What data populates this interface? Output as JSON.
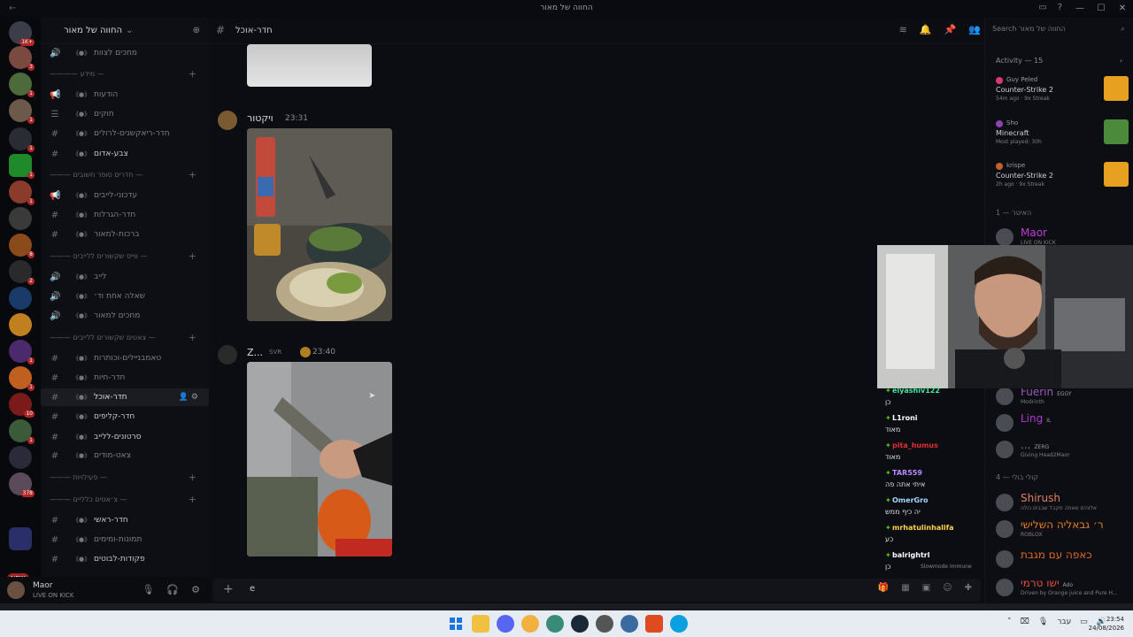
{
  "window": {
    "title": "החווה של מאור",
    "back_glyph": "←",
    "controls": [
      "—",
      "☐",
      "✕"
    ],
    "top_icons": [
      "▭",
      "?"
    ]
  },
  "servers": {
    "new_label": "NEW",
    "badges": [
      "1K+",
      "3",
      "1",
      "1",
      "1",
      "1",
      "1",
      "8",
      "2",
      "1",
      "1",
      "10",
      "1",
      "378"
    ]
  },
  "guild": {
    "name": "החווה של מאור",
    "chevron": "⌄",
    "add_member_icon": "user-plus-icon"
  },
  "channels": [
    {
      "type": "channel",
      "name": "מחכים לצוות",
      "icon": "speaker"
    },
    {
      "type": "category",
      "name": "———— מידע —"
    },
    {
      "type": "channel",
      "name": "הודעות",
      "icon": "megaphone"
    },
    {
      "type": "channel",
      "name": "חוקים",
      "icon": "book"
    },
    {
      "type": "channel",
      "name": "חדר-ריאקשנים-לרולים",
      "icon": "hash"
    },
    {
      "type": "channel",
      "name": "צבע-אדום",
      "icon": "hash",
      "bright": true
    },
    {
      "type": "category",
      "name": "——— חדרים סופר חשובים —"
    },
    {
      "type": "channel",
      "name": "עדכוני-לייבים",
      "icon": "megaphone"
    },
    {
      "type": "channel",
      "name": "חדר-הגרלות",
      "icon": "hash"
    },
    {
      "type": "channel",
      "name": "ברכות-למאור",
      "icon": "hash"
    },
    {
      "type": "category",
      "name": "——— ווייס שקשורים ללייבים —"
    },
    {
      "type": "channel",
      "name": "לייב",
      "icon": "speaker"
    },
    {
      "type": "channel",
      "name": "שאלה אחת וד׳",
      "icon": "speaker"
    },
    {
      "type": "channel",
      "name": "מחכים למאור",
      "icon": "speaker"
    },
    {
      "type": "category",
      "name": "——— צאטים שקשורים ללייבים —"
    },
    {
      "type": "channel",
      "name": "טאמבניילים-וכותרות",
      "icon": "hash"
    },
    {
      "type": "channel",
      "name": "חדר-חיות",
      "icon": "hash"
    },
    {
      "type": "channel",
      "name": "חדר-אוכל",
      "icon": "hash",
      "active": true
    },
    {
      "type": "channel",
      "name": "חדר-קליפים",
      "icon": "hash",
      "bright": true
    },
    {
      "type": "channel",
      "name": "סרטונים-ללייב",
      "icon": "hash",
      "bright": true
    },
    {
      "type": "channel",
      "name": "צאט-מודים",
      "icon": "hash"
    },
    {
      "type": "category",
      "name": "——— פעילויות —"
    },
    {
      "type": "category",
      "name": "——— צ׳אטים כלליים —"
    },
    {
      "type": "channel",
      "name": "חדר-ראשי",
      "icon": "hash",
      "bright": true
    },
    {
      "type": "channel",
      "name": "תמונות-ומימים",
      "icon": "hash"
    },
    {
      "type": "channel",
      "name": "פקודות-לבוטים",
      "icon": "hash",
      "bright": true
    }
  ],
  "user_panel": {
    "name": "Maor",
    "status": "LIVE ON KICK"
  },
  "main": {
    "channel_name": "חדר-אוכל",
    "composer_value": "e",
    "messages": [
      {
        "author": "ויקטור",
        "time": "23:31"
      },
      {
        "author": "Z...",
        "tag": "SVR",
        "time": "23:40"
      }
    ]
  },
  "right": {
    "search_placeholder": "Search החווה של מאור",
    "activity_header": "Activity — 15",
    "activities": [
      {
        "user": "Guy Peled",
        "game": "Counter-Strike 2",
        "meta": "54m ago · 9x Streak",
        "color": "#d23d6b"
      },
      {
        "user": "Sho",
        "game": "Minecraft",
        "meta": "Most played: 30h",
        "color": "#8e44ad"
      },
      {
        "user": "krispe",
        "game": "Counter-Strike 2",
        "meta": "2h ago · 9x Streak",
        "color": "#c06030"
      }
    ],
    "sections": [
      {
        "name": "האיטר — 1"
      },
      {
        "name": "קולי בולי — 4"
      }
    ],
    "members": [
      {
        "name": "Maor",
        "sub": "LIVE ON KICK",
        "color": "#c23bd6"
      },
      {
        "name": "Fuerin",
        "sub": "Modrinth",
        "color": "#9b59b6",
        "tag": "EGGY"
      },
      {
        "name": "Ling",
        "sub": "",
        "color": "#b03ad0",
        "tag": "IL"
      },
      {
        "name": "...",
        "sub": "Giving Head2Maor",
        "color": "#c040e0",
        "tag": "ZERG"
      },
      {
        "name": "Shirush",
        "sub": "אלוהים שאתה מקבל שבבים כולה",
        "color": "#e08060"
      },
      {
        "name": "ר׳ גבאליה השלישי",
        "sub": "ROBLOX",
        "color": "#e67e22"
      },
      {
        "name": "כאפה עם מגבת",
        "sub": "",
        "color": "#e06a20"
      },
      {
        "name": "ישו טרמי",
        "sub": "Driven by Orange juice and Pure H...",
        "color": "#e74c3c",
        "tag": "Ado"
      }
    ]
  },
  "kick_chat": [
    {
      "name": "elyashiv122",
      "msg": "כן",
      "color": "#42e8a0"
    },
    {
      "name": "L1roni",
      "msg": "מאוד",
      "color": "#ffffff"
    },
    {
      "name": "pita_humus",
      "msg": "מאוד",
      "color": "#e03030"
    },
    {
      "name": "TAR559",
      "msg": "איתי אתה פה",
      "color": "#b48cff"
    },
    {
      "name": "OmerGro",
      "msg": "יה כיף ממש",
      "color": "#a0d8ff"
    },
    {
      "name": "mrhatulinhalifa",
      "msg": "כע",
      "color": "#ffd24a"
    },
    {
      "name": "balrightrl",
      "msg": "כן",
      "color": "#ffffff"
    }
  ],
  "slowmode": "Slowmode Immune",
  "taskbar": {
    "lang": "עבר",
    "time": "23:54",
    "date": "24/08/2026"
  }
}
